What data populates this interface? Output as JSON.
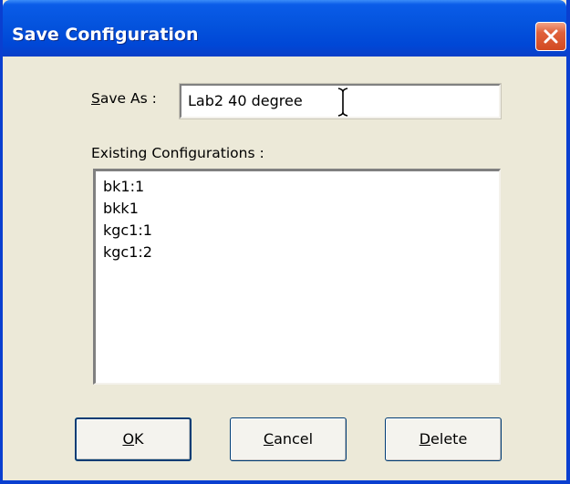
{
  "window": {
    "title": "Save Configuration"
  },
  "form": {
    "save_as_access": "S",
    "save_as_label_rest": "ave As :",
    "save_as_value": "Lab2 40 degree",
    "existing_label": "Existing Configurations :"
  },
  "list": {
    "items": [
      "bk1:1",
      "bkk1",
      "kgc1:1",
      "kgc1:2"
    ]
  },
  "buttons": {
    "ok_access": "O",
    "ok_rest": "K",
    "cancel_access": "C",
    "cancel_rest": "ancel",
    "delete_access": "D",
    "delete_rest": "elete"
  },
  "icons": {
    "close": "close-icon",
    "cursor": "text-cursor-icon"
  },
  "colors": {
    "titlebar": "#0453DD",
    "close_button": "#D24A22",
    "dialog_bg": "#ECE9D8"
  }
}
